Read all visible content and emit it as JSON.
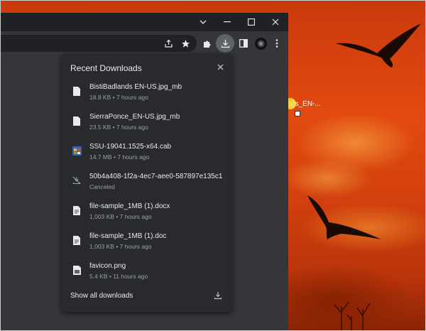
{
  "desktop": {
    "file_label": "BistiBadlands_EN-..."
  },
  "window": {
    "controls": {
      "chevron": "⌄",
      "minimize": "—",
      "maximize": "☐",
      "close": "✕"
    }
  },
  "toolbar": {
    "icons": [
      "share-icon",
      "star-icon",
      "extensions-icon",
      "download-icon",
      "side-panel-icon",
      "profile-avatar",
      "menu-icon"
    ]
  },
  "downloads": {
    "title": "Recent Downloads",
    "close_label": "✕",
    "items": [
      {
        "name": "BistiBadlands EN-US.jpg_mb",
        "meta": "18.8 KB • 7 hours ago",
        "icon": "file-icon"
      },
      {
        "name": "SierraPonce_EN-US.jpg_mb",
        "meta": "23.5 KB • 7 hours ago",
        "icon": "file-icon"
      },
      {
        "name": "SSU-19041.1525-x64.cab",
        "meta": "14.7 MB • 7 hours ago",
        "icon": "cab-archive-icon"
      },
      {
        "name": "50b4a408-1f2a-4ec7-aee0-587897e135c1",
        "meta": "Canceled",
        "icon": "download-off-icon"
      },
      {
        "name": "file-sample_1MB (1).docx",
        "meta": "1,003 KB • 7 hours ago",
        "icon": "file-icon"
      },
      {
        "name": "file-sample_1MB (1).doc",
        "meta": "1,003 KB • 7 hours ago",
        "icon": "file-icon"
      },
      {
        "name": "favicon.png",
        "meta": "5.4 KB • 11 hours ago",
        "icon": "image-file-icon"
      }
    ],
    "show_all_label": "Show all downloads"
  },
  "colors": {
    "titlebar": "#202124",
    "toolbar": "#35363a",
    "popup": "#292a2d",
    "text": "#e8eaed",
    "muted": "#9aa0a6"
  }
}
